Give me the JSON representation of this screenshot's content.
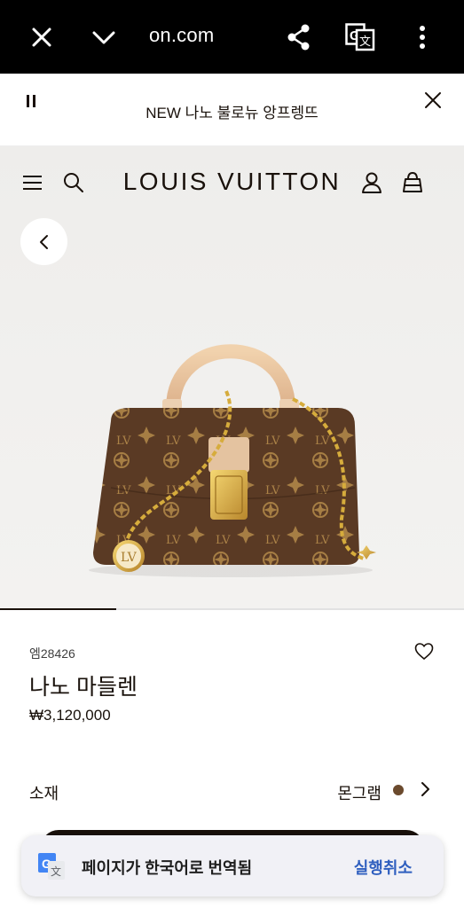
{
  "browser": {
    "url_fragment": "on.com",
    "icons": [
      "close-icon",
      "chevron-down-icon",
      "share-icon",
      "translate-icon",
      "more-vert-icon"
    ]
  },
  "announcement": {
    "text": "NEW 나노 불로뉴 앙프렝뜨"
  },
  "header": {
    "logo": "LOUIS VUITTON"
  },
  "gallery": {
    "progress": 0.25
  },
  "product": {
    "sku": "엠28426",
    "name": "나노 마들렌",
    "price": "₩3,120,000",
    "material_label": "소재",
    "material_value": "몬그램",
    "swatch_color": "#6b4a2d"
  },
  "translate_toast": {
    "message": "페이지가 한국어로 번역됨",
    "undo": "실행취소"
  },
  "colors": {
    "primary": "#19110b",
    "toast_bg": "#f1f1f6",
    "toast_link": "#2f5fbf"
  }
}
